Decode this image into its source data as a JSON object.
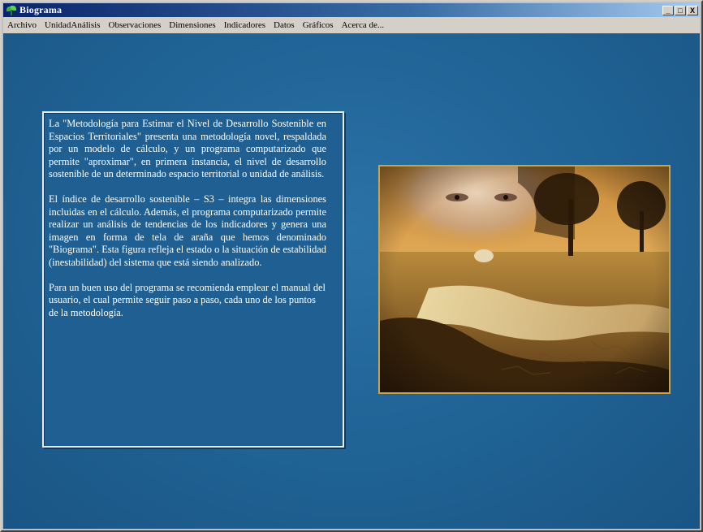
{
  "window": {
    "title": "Biograma",
    "controls": [
      "_",
      "□",
      "X"
    ]
  },
  "menu": [
    {
      "label": "Archivo"
    },
    {
      "label": "UnidadAnálisis"
    },
    {
      "label": "Observaciones"
    },
    {
      "label": "Dimensiones"
    },
    {
      "label": "Indicadores"
    },
    {
      "label": "Datos"
    },
    {
      "label": "Gráficos"
    },
    {
      "label": "Acerca de..."
    }
  ],
  "intro": {
    "paragraphs": [
      "La \"Metodología para Estimar el Nivel de Desarrollo Sostenible en Espacios Territoriales\" presenta una metodología novel, respaldada por un modelo de cálculo, y un programa computarizado que permite \"aproximar\", en primera instancia, el nivel de desarrollo sostenible de un determinado espacio territorial o unidad de análisis.",
      "El índice de desarrollo sostenible – S3 – integra las dimensiones incluidas en el cálculo. Además, el programa computarizado permite realizar un análisis de tendencias de los indicadores y genera una imagen en forma de tela de araña que hemos denominado \"Biograma\". Esta figura refleja el estado o la situación de estabilidad (inestabilidad) del sistema que está siendo analizado.",
      "Para un buen uso del programa se recomienda emplear el manual del usuario, el cual permite seguir paso a paso, cada uno de los puntos de la metodología."
    ]
  },
  "colors": {
    "background": "#1f6294",
    "titlebar": "#0a246a",
    "frame": "#caa24a"
  },
  "icons": {
    "app": "leaf-icon",
    "minimize": "minimize-icon",
    "maximize": "maximize-icon",
    "close": "close-icon"
  }
}
